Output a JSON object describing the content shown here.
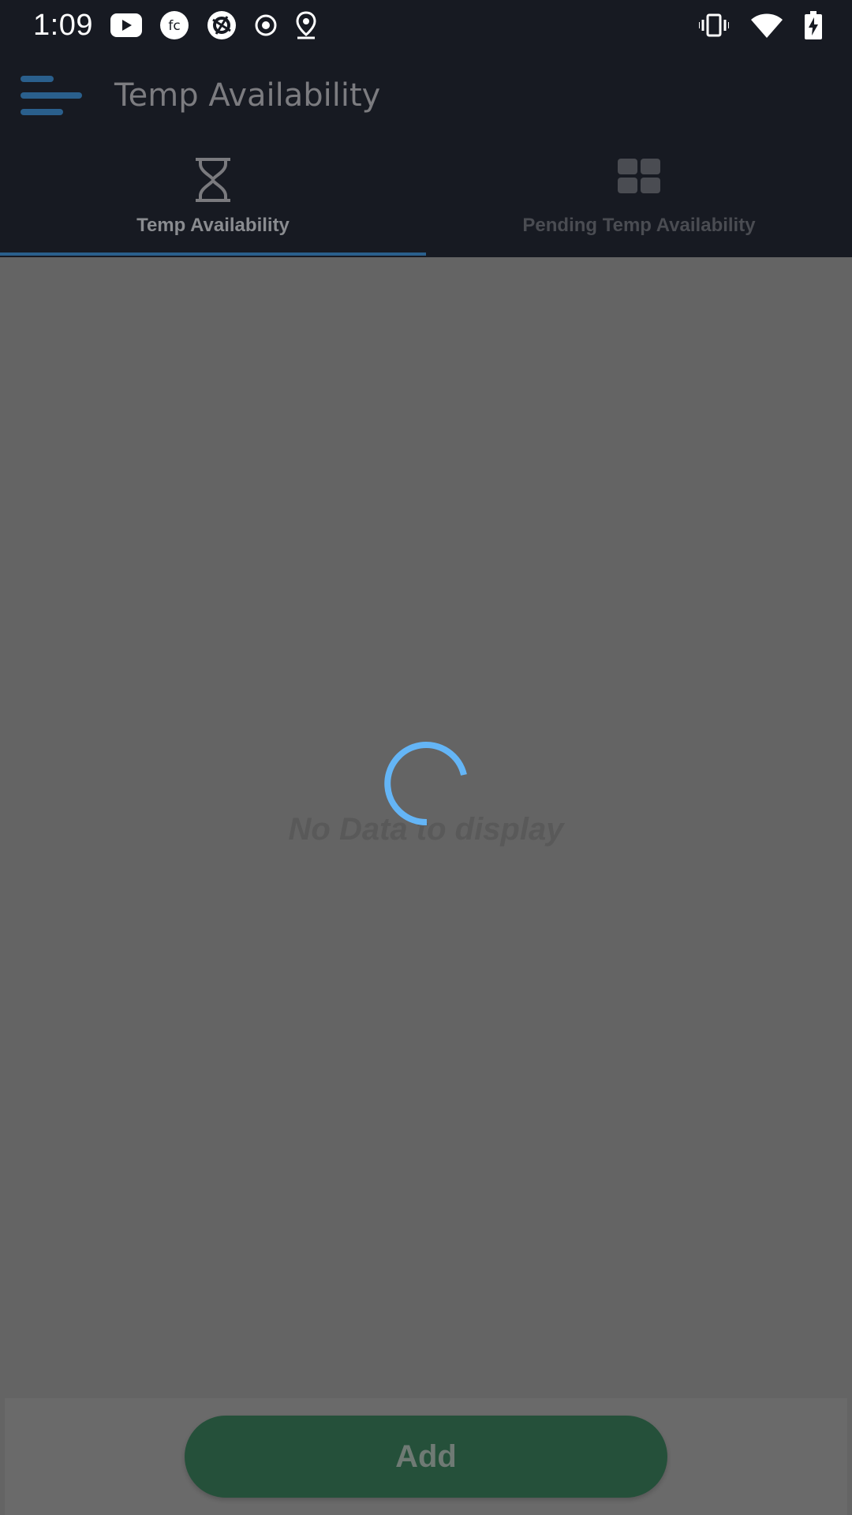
{
  "status_bar": {
    "time": "1:09",
    "left_icons": [
      "youtube-icon",
      "fc-app-icon",
      "shutter-app-icon",
      "record-icon",
      "location-pin-icon"
    ],
    "right_icons": [
      "vibrate-icon",
      "wifi-icon",
      "battery-charging-icon"
    ]
  },
  "app_bar": {
    "title": "Temp Availability",
    "menu_icon": "menu-icon"
  },
  "tabs": [
    {
      "label": "Temp Availability",
      "icon": "hourglass-icon",
      "selected": true
    },
    {
      "label": "Pending Temp Availability",
      "icon": "grid-icon",
      "selected": false
    }
  ],
  "content": {
    "empty_message": "No Data to display",
    "loading": true
  },
  "footer": {
    "add_label": "Add"
  },
  "colors": {
    "app_bar_bg": "#171a22",
    "content_bg": "#646464",
    "tab_indicator": "#2a5f8c",
    "spinner": "#64b5f6",
    "add_button": "#25503a"
  }
}
